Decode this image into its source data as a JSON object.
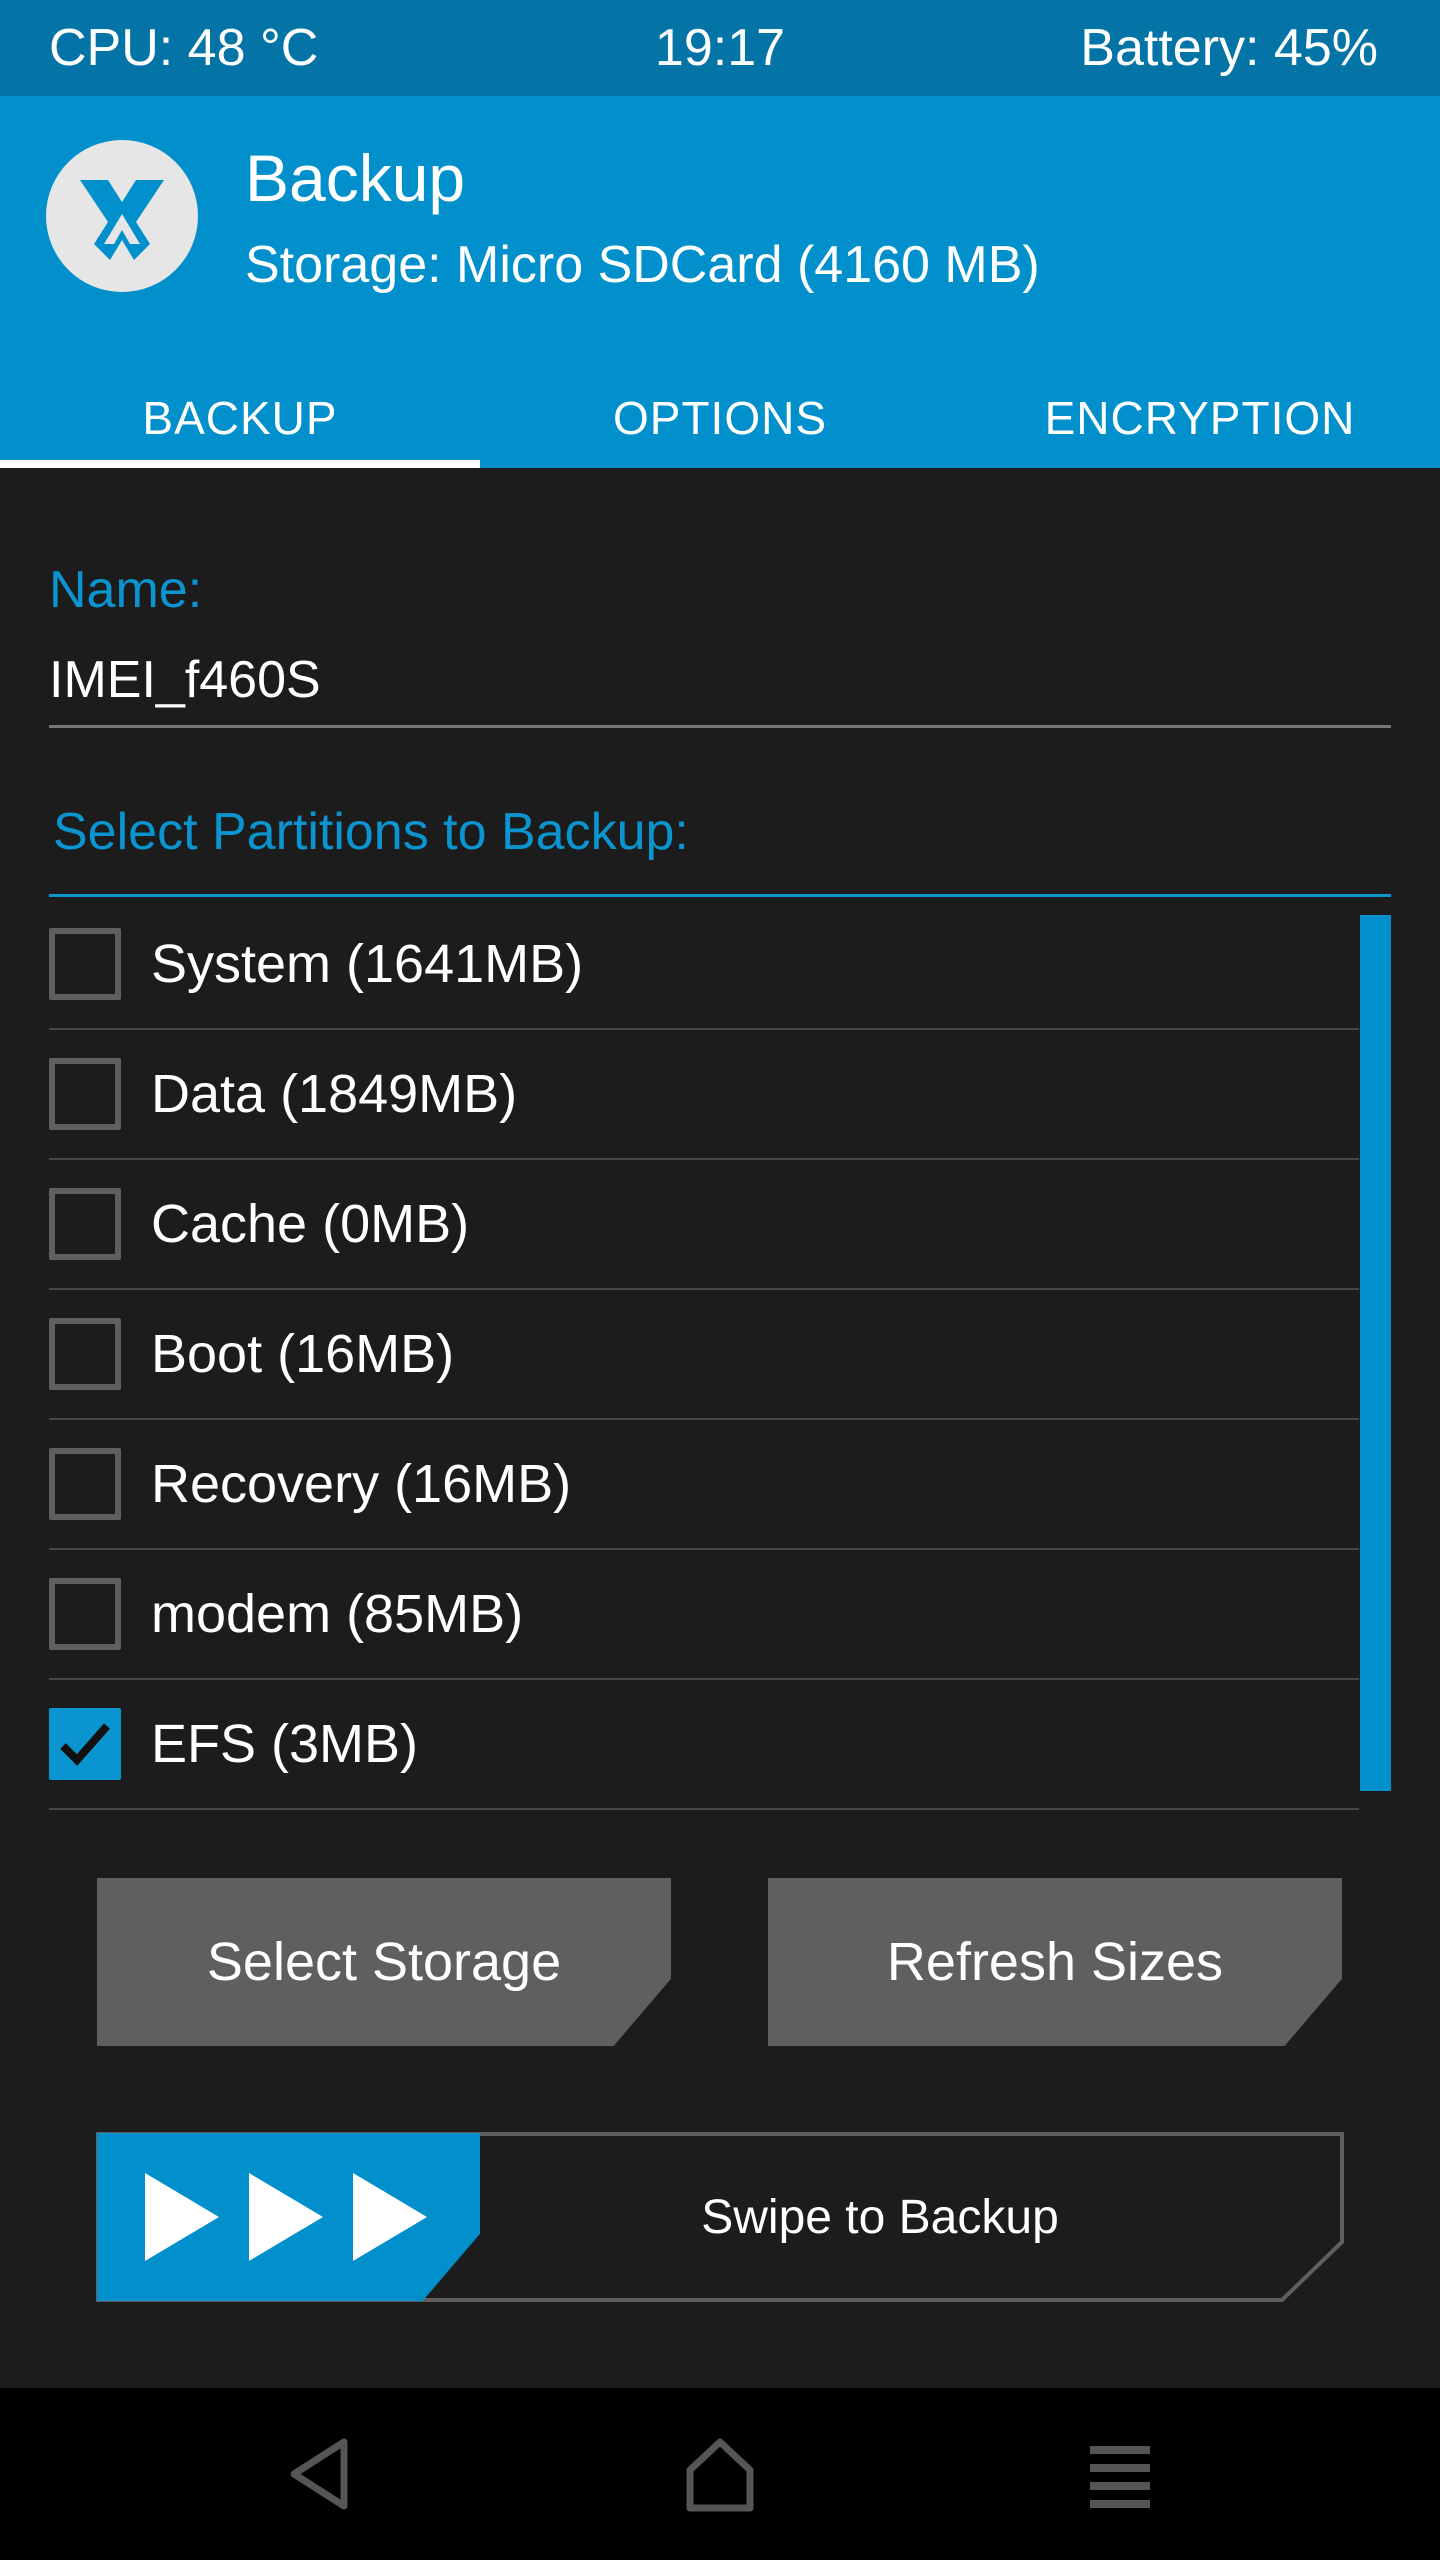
{
  "status_bar": {
    "cpu": "CPU: 48 °C",
    "time": "19:17",
    "battery": "Battery: 45%"
  },
  "header": {
    "title": "Backup",
    "subtitle": "Storage: Micro SDCard (4160 MB)"
  },
  "tabs": [
    {
      "label": "BACKUP",
      "active": true
    },
    {
      "label": "OPTIONS",
      "active": false
    },
    {
      "label": "ENCRYPTION",
      "active": false
    }
  ],
  "name_field": {
    "label": "Name:",
    "value": "IMEI_f460S"
  },
  "partitions": {
    "label": "Select Partitions to Backup:",
    "items": [
      {
        "label": "System (1641MB)",
        "checked": false
      },
      {
        "label": "Data (1849MB)",
        "checked": false
      },
      {
        "label": "Cache (0MB)",
        "checked": false
      },
      {
        "label": "Boot (16MB)",
        "checked": false
      },
      {
        "label": "Recovery (16MB)",
        "checked": false
      },
      {
        "label": "modem (85MB)",
        "checked": false
      },
      {
        "label": "EFS (3MB)",
        "checked": true
      }
    ]
  },
  "buttons": {
    "select_storage": "Select Storage",
    "refresh_sizes": "Refresh Sizes"
  },
  "swipe": {
    "label": "Swipe to Backup"
  },
  "nav": {
    "back_icon": "back-icon",
    "home_icon": "home-icon",
    "menu_icon": "menu-icon"
  },
  "colors": {
    "accent": "#0190cb",
    "status_bar": "#0473a6",
    "background": "#1c1c1c",
    "button": "#5f5f5f"
  }
}
